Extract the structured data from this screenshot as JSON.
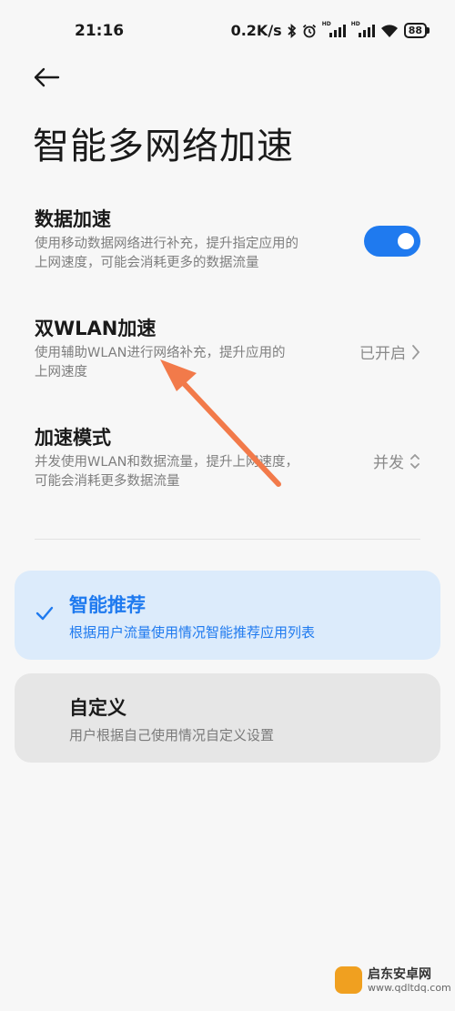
{
  "status_bar": {
    "time": "21:16",
    "net_speed": "0.2K/s",
    "battery": "88",
    "icons": [
      "bluetooth-icon",
      "alarm-icon",
      "signal-hd-icon",
      "signal-hd-icon",
      "wifi-icon",
      "battery-icon"
    ]
  },
  "page": {
    "title": "智能多网络加速"
  },
  "settings": {
    "data_accel": {
      "title": "数据加速",
      "desc_line1": "使用移动数据网络进行补充，提升指定应用的",
      "desc_line2": "上网速度，可能会消耗更多的数据流量",
      "enabled": true
    },
    "dual_wlan": {
      "title": "双WLAN加速",
      "desc_line1": "使用辅助WLAN进行网络补充，提升应用的",
      "desc_line2": "上网速度",
      "value": "已开启"
    },
    "accel_mode": {
      "title": "加速模式",
      "desc_line1": "并发使用WLAN和数据流量，提升上网速度，",
      "desc_line2": "可能会消耗更多数据流量",
      "value": "并发"
    }
  },
  "options": {
    "smart": {
      "title": "智能推荐",
      "desc": "根据用户流量使用情况智能推荐应用列表",
      "selected": true
    },
    "custom": {
      "title": "自定义",
      "desc": "用户根据自己使用情况自定义设置",
      "selected": false
    }
  },
  "colors": {
    "accent": "#1f7aef",
    "annotation_arrow": "#f27a4a",
    "selected_card_bg": "#dcebfb",
    "unselected_card_bg": "#e6e6e6"
  },
  "watermark": {
    "name": "启东安卓网",
    "url": "www.qdltdq.com"
  }
}
